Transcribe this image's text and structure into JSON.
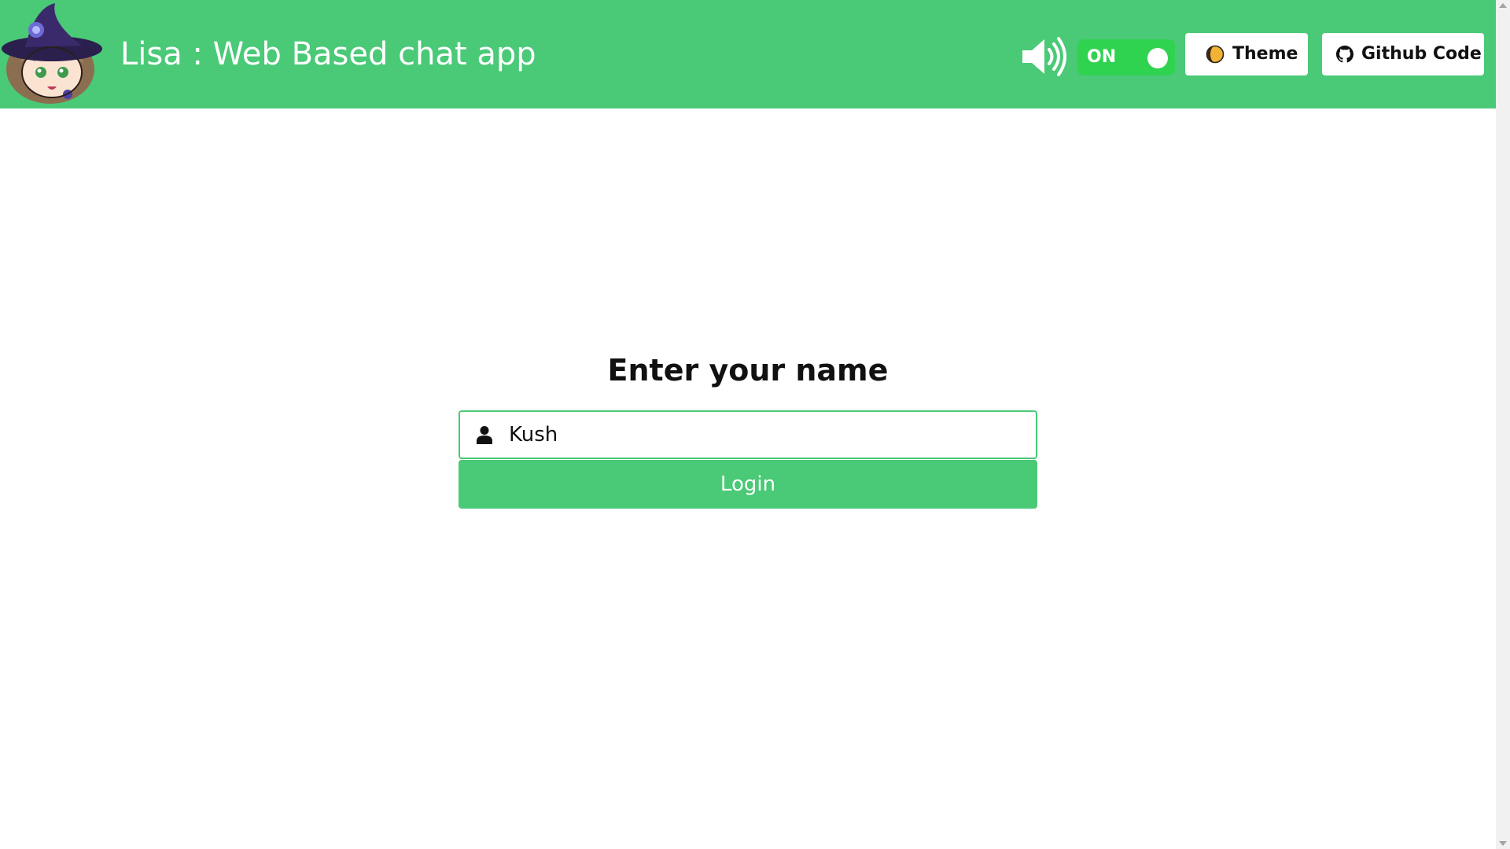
{
  "colors": {
    "brand_green": "#4ac977",
    "toggle_green": "#30d350",
    "text_dark": "#111111",
    "white": "#ffffff"
  },
  "header": {
    "logo_icon": "chibi-witch-avatar-icon",
    "title": "Lisa : Web Based chat app",
    "sound_icon": "speaker-volume-icon",
    "sound_toggle": {
      "label": "ON",
      "state": true
    },
    "theme_button": {
      "icon": "half-moon-theme-icon",
      "label": "Theme"
    },
    "github_button": {
      "icon": "github-icon",
      "label": "Github Code"
    }
  },
  "login": {
    "heading": "Enter your name",
    "name_input": {
      "icon": "user-icon",
      "value": "Kush",
      "placeholder": ""
    },
    "login_button": "Login"
  }
}
